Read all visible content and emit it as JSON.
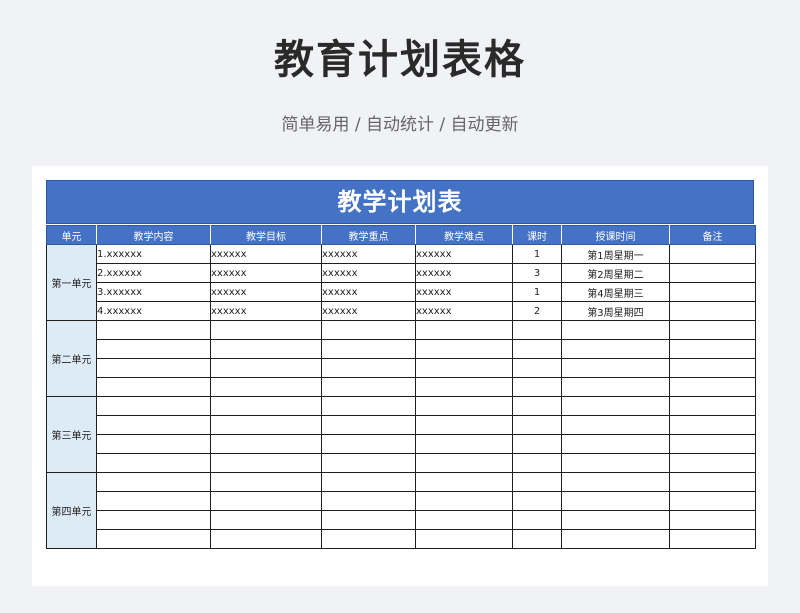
{
  "header": {
    "title": "教育计划表格",
    "subtitle": "简单易用 / 自动统计 / 自动更新"
  },
  "sheet": {
    "banner": "教学计划表",
    "columns": [
      "单元",
      "教学内容",
      "教学目标",
      "教学重点",
      "教学难点",
      "课时",
      "授课时间",
      "备注"
    ],
    "units": [
      {
        "name": "第一单元",
        "rows": [
          {
            "content": "1.xxxxxx",
            "goal": "xxxxxx",
            "key": "xxxxxx",
            "difficulty": "xxxxxx",
            "hours": "1",
            "time": "第1周星期一",
            "note": ""
          },
          {
            "content": "2.xxxxxx",
            "goal": "xxxxxx",
            "key": "xxxxxx",
            "difficulty": "xxxxxx",
            "hours": "3",
            "time": "第2周星期二",
            "note": ""
          },
          {
            "content": "3.xxxxxx",
            "goal": "xxxxxx",
            "key": "xxxxxx",
            "difficulty": "xxxxxx",
            "hours": "1",
            "time": "第4周星期三",
            "note": ""
          },
          {
            "content": "4.xxxxxx",
            "goal": "xxxxxx",
            "key": "xxxxxx",
            "difficulty": "xxxxxx",
            "hours": "2",
            "time": "第3周星期四",
            "note": ""
          }
        ]
      },
      {
        "name": "第二单元",
        "rows": [
          {
            "content": "",
            "goal": "",
            "key": "",
            "difficulty": "",
            "hours": "",
            "time": "",
            "note": ""
          },
          {
            "content": "",
            "goal": "",
            "key": "",
            "difficulty": "",
            "hours": "",
            "time": "",
            "note": ""
          },
          {
            "content": "",
            "goal": "",
            "key": "",
            "difficulty": "",
            "hours": "",
            "time": "",
            "note": ""
          },
          {
            "content": "",
            "goal": "",
            "key": "",
            "difficulty": "",
            "hours": "",
            "time": "",
            "note": ""
          }
        ]
      },
      {
        "name": "第三单元",
        "rows": [
          {
            "content": "",
            "goal": "",
            "key": "",
            "difficulty": "",
            "hours": "",
            "time": "",
            "note": ""
          },
          {
            "content": "",
            "goal": "",
            "key": "",
            "difficulty": "",
            "hours": "",
            "time": "",
            "note": ""
          },
          {
            "content": "",
            "goal": "",
            "key": "",
            "difficulty": "",
            "hours": "",
            "time": "",
            "note": ""
          },
          {
            "content": "",
            "goal": "",
            "key": "",
            "difficulty": "",
            "hours": "",
            "time": "",
            "note": ""
          }
        ]
      },
      {
        "name": "第四单元",
        "rows": [
          {
            "content": "",
            "goal": "",
            "key": "",
            "difficulty": "",
            "hours": "",
            "time": "",
            "note": ""
          },
          {
            "content": "",
            "goal": "",
            "key": "",
            "difficulty": "",
            "hours": "",
            "time": "",
            "note": ""
          },
          {
            "content": "",
            "goal": "",
            "key": "",
            "difficulty": "",
            "hours": "",
            "time": "",
            "note": ""
          },
          {
            "content": "",
            "goal": "",
            "key": "",
            "difficulty": "",
            "hours": "",
            "time": "",
            "note": ""
          }
        ]
      }
    ]
  },
  "colors": {
    "accent": "#4472c4",
    "unit_cell": "#ddebf7",
    "page_bg": "#f1f2f5"
  }
}
